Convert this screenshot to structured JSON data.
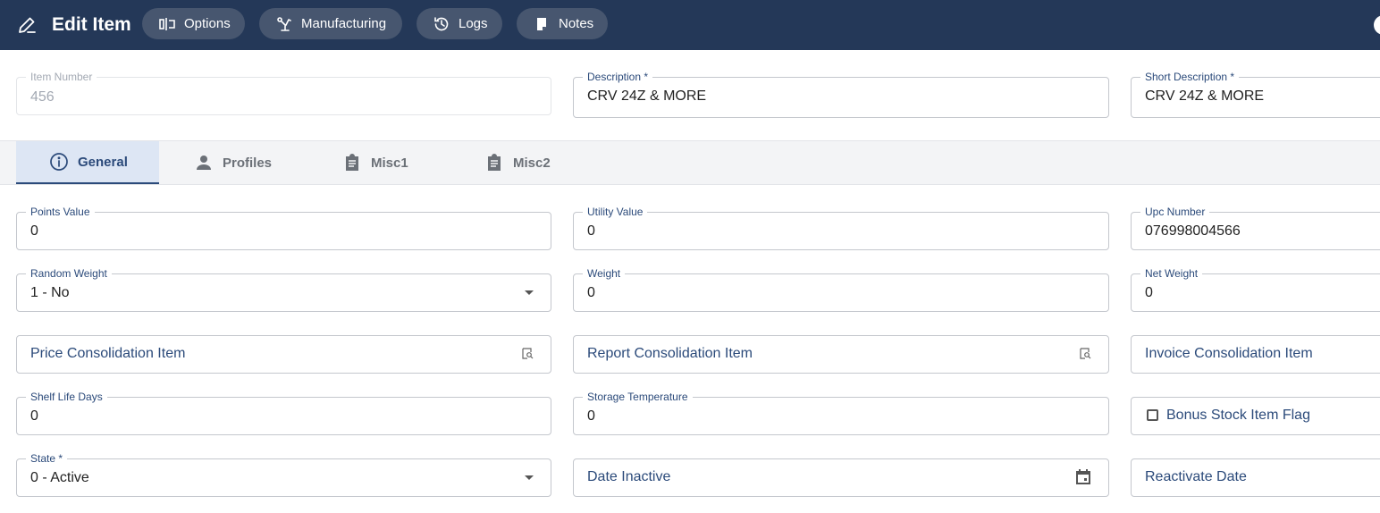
{
  "header": {
    "title": "Edit Item",
    "buttons": [
      {
        "label": "Options",
        "icon": "options-icon"
      },
      {
        "label": "Manufacturing",
        "icon": "robot-arm-icon"
      },
      {
        "label": "Logs",
        "icon": "history-icon"
      },
      {
        "label": "Notes",
        "icon": "notes-icon"
      }
    ],
    "colors": {
      "background": "#243858",
      "pill": "#47566f"
    }
  },
  "top_fields": {
    "item_number": {
      "label": "Item Number",
      "value": "456"
    },
    "description": {
      "label": "Description *",
      "value": "CRV 24Z & MORE"
    },
    "short_description": {
      "label": "Short Description *",
      "value": "CRV 24Z & MORE"
    }
  },
  "tabs": [
    {
      "label": "General",
      "icon": "info-icon",
      "active": true
    },
    {
      "label": "Profiles",
      "icon": "person-icon",
      "active": false
    },
    {
      "label": "Misc1",
      "icon": "clipboard-icon",
      "active": false
    },
    {
      "label": "Misc2",
      "icon": "clipboard-icon",
      "active": false
    }
  ],
  "general": {
    "points_value": {
      "label": "Points Value",
      "value": "0"
    },
    "utility_value": {
      "label": "Utility Value",
      "value": "0"
    },
    "upc_number": {
      "label": "Upc Number",
      "value": "076998004566"
    },
    "random_weight": {
      "label": "Random Weight",
      "value": "1 - No"
    },
    "weight": {
      "label": "Weight",
      "value": "0"
    },
    "net_weight": {
      "label": "Net Weight",
      "value": "0"
    },
    "price_consolidation_item": {
      "placeholder": "Price Consolidation Item"
    },
    "report_consolidation_item": {
      "placeholder": "Report Consolidation Item"
    },
    "invoice_consolidation_item": {
      "placeholder": "Invoice Consolidation Item"
    },
    "shelf_life_days": {
      "label": "Shelf Life Days",
      "value": "0"
    },
    "storage_temperature": {
      "label": "Storage Temperature",
      "value": "0"
    },
    "bonus_stock_item_flag": {
      "label": "Bonus Stock Item Flag",
      "checked": false
    },
    "state": {
      "label": "State *",
      "value": "0 - Active"
    },
    "date_inactive": {
      "placeholder": "Date Inactive"
    },
    "reactivate_date": {
      "placeholder": "Reactivate Date"
    }
  },
  "accent_color": "#2b4a7a"
}
